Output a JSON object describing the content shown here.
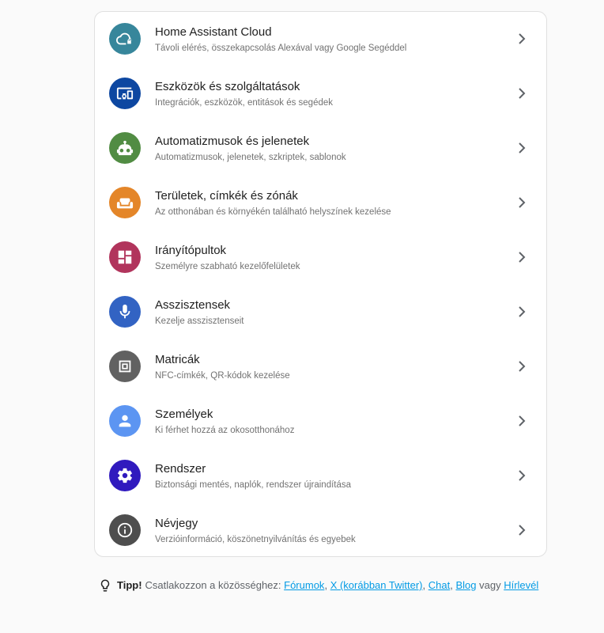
{
  "menu": [
    {
      "title": "Home Assistant Cloud",
      "subtitle": "Távoli elérés, összekapcsolás Alexával vagy Google Segéddel",
      "color": "#37869b",
      "icon": "cloud-lock-icon"
    },
    {
      "title": "Eszközök és szolgáltatások",
      "subtitle": "Integrációk, eszközök, entitások és segédek",
      "color": "#0d47a1",
      "icon": "devices-icon"
    },
    {
      "title": "Automatizmusok és jelenetek",
      "subtitle": "Automatizmusok, jelenetek, szkriptek, sablonok",
      "color": "#518c43",
      "icon": "robot-icon"
    },
    {
      "title": "Területek, címkék és zónák",
      "subtitle": "Az otthonában és környékén található helyszínek kezelése",
      "color": "#e48629",
      "icon": "sofa-icon"
    },
    {
      "title": "Irányítópultok",
      "subtitle": "Személyre szabható kezelőfelületek",
      "color": "#b1345c",
      "icon": "dashboard-icon"
    },
    {
      "title": "Asszisztensek",
      "subtitle": "Kezelje asszisztenseit",
      "color": "#3263c3",
      "icon": "microphone-icon"
    },
    {
      "title": "Matricák",
      "subtitle": "NFC-címkék, QR-kódok kezelése",
      "color": "#616161",
      "icon": "nfc-tag-icon"
    },
    {
      "title": "Személyek",
      "subtitle": "Ki férhet hozzá az okosotthonához",
      "color": "#5c95f2",
      "icon": "account-icon"
    },
    {
      "title": "Rendszer",
      "subtitle": "Biztonsági mentés, naplók, rendszer újraindítása",
      "color": "#301ABE",
      "icon": "cog-icon"
    },
    {
      "title": "Névjegy",
      "subtitle": "Verzióinformáció, köszönetnyilvánítás és egyebek",
      "color": "#4e4e4e",
      "icon": "info-icon"
    }
  ],
  "tip": {
    "label": "Tipp!",
    "text": "Csatlakozzon a közösséghez:",
    "links": [
      "Fórumok",
      "X (korábban Twitter)",
      "Chat",
      "Blog"
    ],
    "separator": ",",
    "conjunction": "vagy",
    "last_link": "Hírlevél"
  }
}
